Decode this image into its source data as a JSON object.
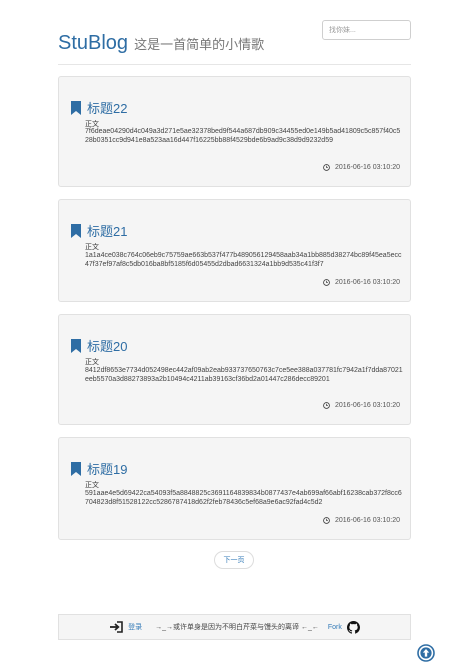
{
  "search": {
    "placeholder": "找你妹..."
  },
  "header": {
    "brand": "StuBlog",
    "tagline": "这是一首简单的小情歌"
  },
  "posts": [
    {
      "title": "标题22",
      "body_label": "正文",
      "body": "7f6deae04290d4c049a3d271e5ae32378bed9f544a687db909c34455ed0e149b5ad41809c5c857f40c528b0351cc9d941e8a523aa16d447f16225bb88f4529bde6b9ad9c38d9d9232d59",
      "date": "2016-06-16 03:10:20"
    },
    {
      "title": "标题21",
      "body_label": "正文",
      "body": "1a1a4ce038c764c06eb9c75759ae663b537f477b489056129458aab34a1bb885d38274bc89f45ea5ecc47f37ef97af8c5db016ba8bf5185f6d05455d2dbad6631324a1bb9d535c41f3f7",
      "date": "2016-06-16 03:10:20"
    },
    {
      "title": "标题20",
      "body_label": "正文",
      "body": "8412df8653e7734d052498ec442af09ab2eab933737650763c7ce5ee388a037781fc7942a1f7dda87021eeb5570a3d88273893a2b10494c4211ab39163cf36bd2a01447c286decc89201",
      "date": "2016-06-16 03:10:20"
    },
    {
      "title": "标题19",
      "body_label": "正文",
      "body": "591aae4e5d69422ca54093f5a8848825c3691164839834b0877437e4ab699af66abf16238cab372f8cc6704823d8f51528122cc5286787418d62f2feb78436c5ef68a9e6ac92fad4c5d2",
      "date": "2016-06-16 03:10:20"
    }
  ],
  "pagination": {
    "next_label": "下一页"
  },
  "footer": {
    "login_label": "登录",
    "message": "→_→或许单身是因为不明白芹菜与馒头的离谛 ←_←",
    "fork_label": "Fork"
  },
  "icons": {
    "bookmark": "bookmark-icon",
    "clock": "clock-icon",
    "login": "sign-in-icon",
    "github": "github-icon",
    "back_to_top": "arrow-circle-up-icon"
  },
  "colors": {
    "accent": "#2e6da4",
    "panel": "#f5f5f5"
  }
}
